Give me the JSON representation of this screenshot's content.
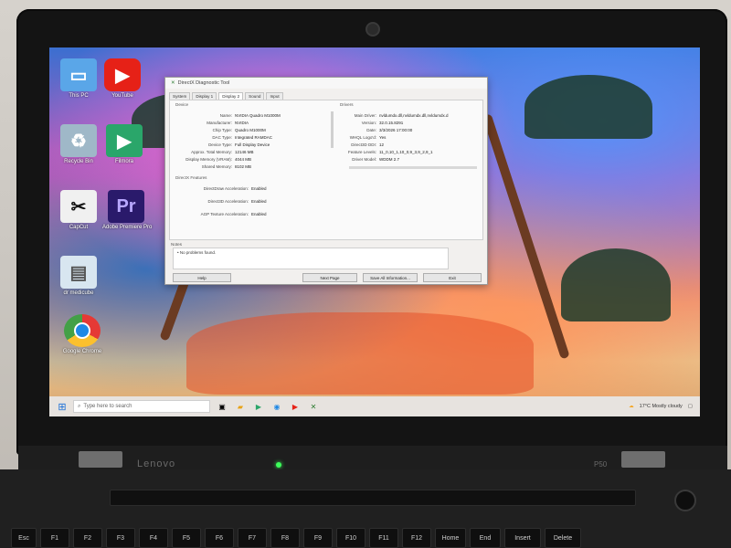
{
  "laptop": {
    "brand": "Lenovo",
    "model": "P50"
  },
  "desktop_icons": [
    {
      "label": "This PC",
      "icon": "pc-icon",
      "color": "#5aa6e8"
    },
    {
      "label": "YouTube",
      "icon": "youtube-icon",
      "color": "#e62117"
    },
    {
      "label": "Recycle Bin",
      "icon": "recycle-bin-icon",
      "color": "#9fb8c8"
    },
    {
      "label": "Filmora",
      "icon": "filmora-icon",
      "color": "#2aa66a"
    },
    {
      "label": "CapCut",
      "icon": "capcut-icon",
      "color": "#111111"
    },
    {
      "label": "Adobe Premiere Pro",
      "icon": "premiere-icon",
      "color": "#2a1a6b"
    },
    {
      "label": "dr medicube",
      "icon": "document-icon",
      "color": "#d8e6f0"
    },
    {
      "label": "Google Chrome",
      "icon": "chrome-icon",
      "color": "#f2c94c"
    }
  ],
  "dxdiag": {
    "title": "DirectX Diagnostic Tool",
    "tabs": [
      "System",
      "Display 1",
      "Display 2",
      "Sound",
      "Input"
    ],
    "device_header": "Device",
    "drivers_header": "Drivers",
    "device_rows": [
      {
        "k": "Name:",
        "v": "NVIDIA Quadro M1000M"
      },
      {
        "k": "Manufacturer:",
        "v": "NVIDIA"
      },
      {
        "k": "Chip Type:",
        "v": "Quadro M1000M"
      },
      {
        "k": "DAC Type:",
        "v": "Integrated RAMDAC"
      },
      {
        "k": "Device Type:",
        "v": "Full Display Device"
      },
      {
        "k": "Approx. Total Memory:",
        "v": "12146 MB"
      },
      {
        "k": "Display Memory (VRAM):",
        "v": "4044 MB"
      },
      {
        "k": "Shared Memory:",
        "v": "8102 MB"
      }
    ],
    "driver_rows": [
      {
        "k": "Main Driver:",
        "v": "nvldumdx.dll,nvldumdx.dll,nvldumdx.d"
      },
      {
        "k": "Version:",
        "v": "32.0.15.8291"
      },
      {
        "k": "Date:",
        "v": "3/3/2026 17:00:00"
      },
      {
        "k": "WHQL Logo'd:",
        "v": "Yes"
      },
      {
        "k": "Direct3D DDI:",
        "v": "12"
      },
      {
        "k": "Feature Levels:",
        "v": "11_0,10_1,10_0,9_3,9_2,9_1"
      },
      {
        "k": "Driver Model:",
        "v": "WDDM 2.7"
      }
    ],
    "features_header": "DirectX Features",
    "features": [
      {
        "k": "DirectDraw Acceleration:",
        "v": "Enabled"
      },
      {
        "k": "Direct3D Acceleration:",
        "v": "Enabled"
      },
      {
        "k": "AGP Texture Acceleration:",
        "v": "Enabled"
      }
    ],
    "notes_header": "Notes",
    "notes_text": "No problems found.",
    "buttons": {
      "help": "Help",
      "next": "Next Page",
      "save": "Save All Information...",
      "exit": "Exit"
    }
  },
  "taskbar": {
    "search_placeholder": "Type here to search",
    "weather": "17°C  Mostly cloudy"
  },
  "keyboard": [
    "Esc",
    "F1",
    "F2",
    "F3",
    "F4",
    "F5",
    "F6",
    "F7",
    "F8",
    "F9",
    "F10",
    "F11",
    "F12",
    "Home",
    "End",
    "Insert",
    "Delete"
  ]
}
